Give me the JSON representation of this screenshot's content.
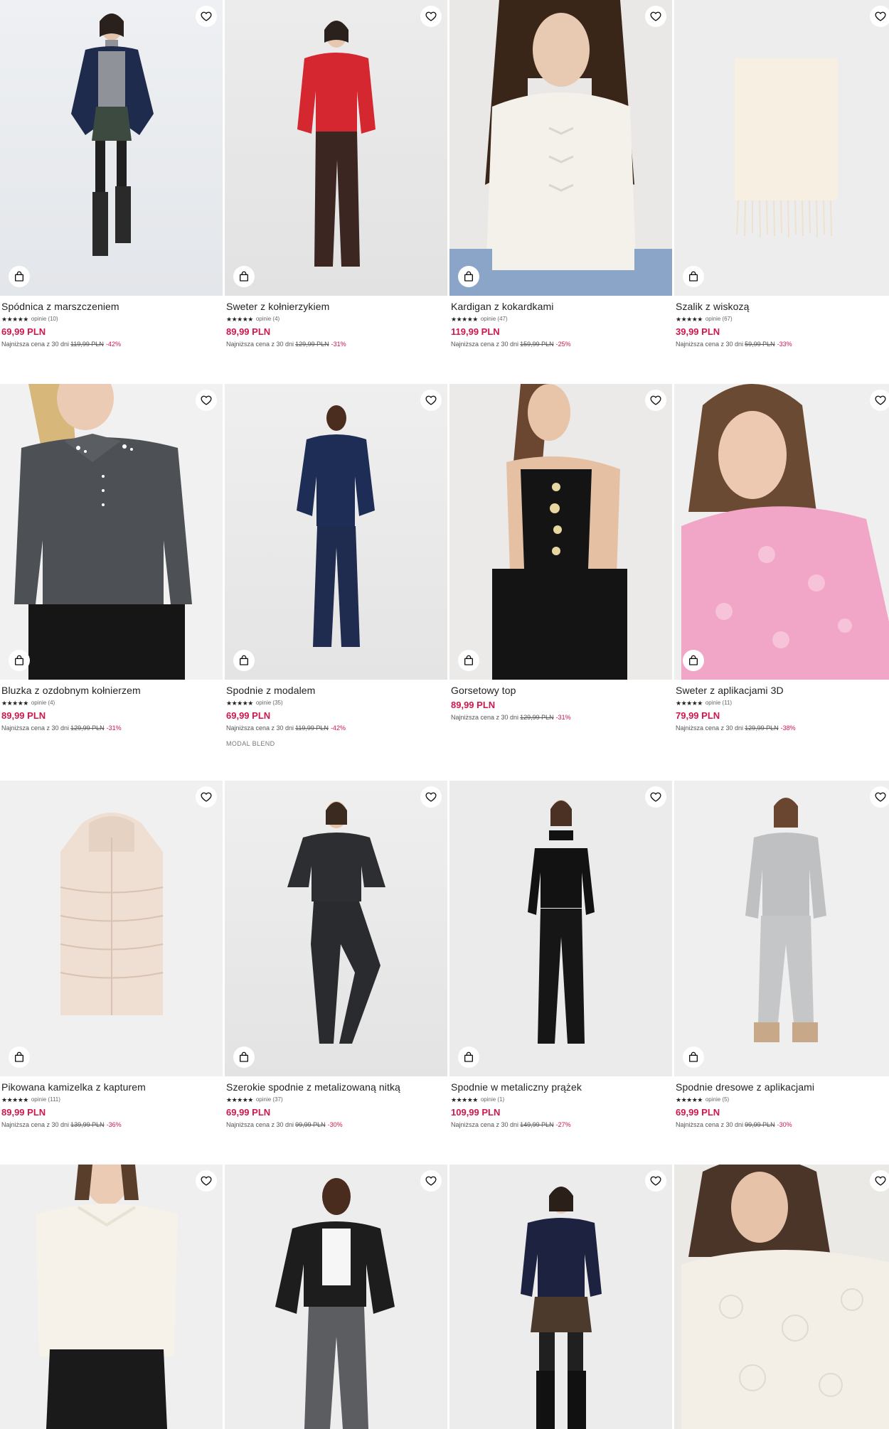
{
  "products": [
    {
      "name": "Spódnica z marszczeniem",
      "stars": "★★★★★",
      "reviews": "opinie (10)",
      "price": "69,99 PLN",
      "lowest_label": "Najniższa cena z 30 dni",
      "old_price": "119,99 PLN",
      "discount": "-42%"
    },
    {
      "name": "Sweter z kołnierzykiem",
      "stars": "★★★★★",
      "reviews": "opinie (4)",
      "price": "89,99 PLN",
      "lowest_label": "Najniższa cena z 30 dni",
      "old_price": "129,99 PLN",
      "discount": "-31%"
    },
    {
      "name": "Kardigan z kokardkami",
      "stars": "★★★★★",
      "reviews": "opinie (47)",
      "price": "119,99 PLN",
      "lowest_label": "Najniższa cena z 30 dni",
      "old_price": "159,99 PLN",
      "discount": "-25%"
    },
    {
      "name": "Szalik z wiskozą",
      "stars": "★★★★★",
      "reviews": "opinie (67)",
      "price": "39,99 PLN",
      "lowest_label": "Najniższa cena z 30 dni",
      "old_price": "59,99 PLN",
      "discount": "-33%"
    },
    {
      "name": "Bluzka z ozdobnym kołnierzem",
      "stars": "★★★★★",
      "reviews": "opinie (4)",
      "price": "89,99 PLN",
      "lowest_label": "Najniższa cena z 30 dni",
      "old_price": "129,99 PLN",
      "discount": "-31%"
    },
    {
      "name": "Spodnie z modalem",
      "stars": "★★★★★",
      "reviews": "opinie (35)",
      "price": "69,99 PLN",
      "lowest_label": "Najniższa cena z 30 dni",
      "old_price": "119,99 PLN",
      "discount": "-42%",
      "tag": "MODAL BLEND"
    },
    {
      "name": "Gorsetowy top",
      "price": "89,99 PLN",
      "lowest_label": "Najniższa cena z 30 dni",
      "old_price": "129,99 PLN",
      "discount": "-31%"
    },
    {
      "name": "Sweter z aplikacjami 3D",
      "stars": "★★★★★",
      "reviews": "opinie (11)",
      "price": "79,99 PLN",
      "lowest_label": "Najniższa cena z 30 dni",
      "old_price": "129,99 PLN",
      "discount": "-38%"
    },
    {
      "name": "Pikowana kamizelka z kapturem",
      "stars": "★★★★★",
      "reviews": "opinie (111)",
      "price": "89,99 PLN",
      "lowest_label": "Najniższa cena z 30 dni",
      "old_price": "139,99 PLN",
      "discount": "-36%"
    },
    {
      "name": "Szerokie spodnie z metalizowaną nitką",
      "stars": "★★★★★",
      "reviews": "opinie (37)",
      "price": "69,99 PLN",
      "lowest_label": "Najniższa cena z 30 dni",
      "old_price": "99,99 PLN",
      "discount": "-30%"
    },
    {
      "name": "Spodnie w metaliczny prążek",
      "stars": "★★★★★",
      "reviews": "opinie (1)",
      "price": "109,99 PLN",
      "lowest_label": "Najniższa cena z 30 dni",
      "old_price": "149,99 PLN",
      "discount": "-27%"
    },
    {
      "name": "Spodnie dresowe z aplikacjami",
      "stars": "★★★★★",
      "reviews": "opinie (5)",
      "price": "69,99 PLN",
      "lowest_label": "Najniższa cena z 30 dni",
      "old_price": "99,99 PLN",
      "discount": "-30%"
    },
    {
      "name": ""
    },
    {
      "name": ""
    },
    {
      "name": ""
    },
    {
      "name": ""
    }
  ],
  "icons": {
    "wishlist": "heart-icon",
    "cart": "shopping-bag-icon"
  },
  "colors": {
    "price": "#d0174b",
    "discount": "#d0174b",
    "text": "#222222"
  }
}
